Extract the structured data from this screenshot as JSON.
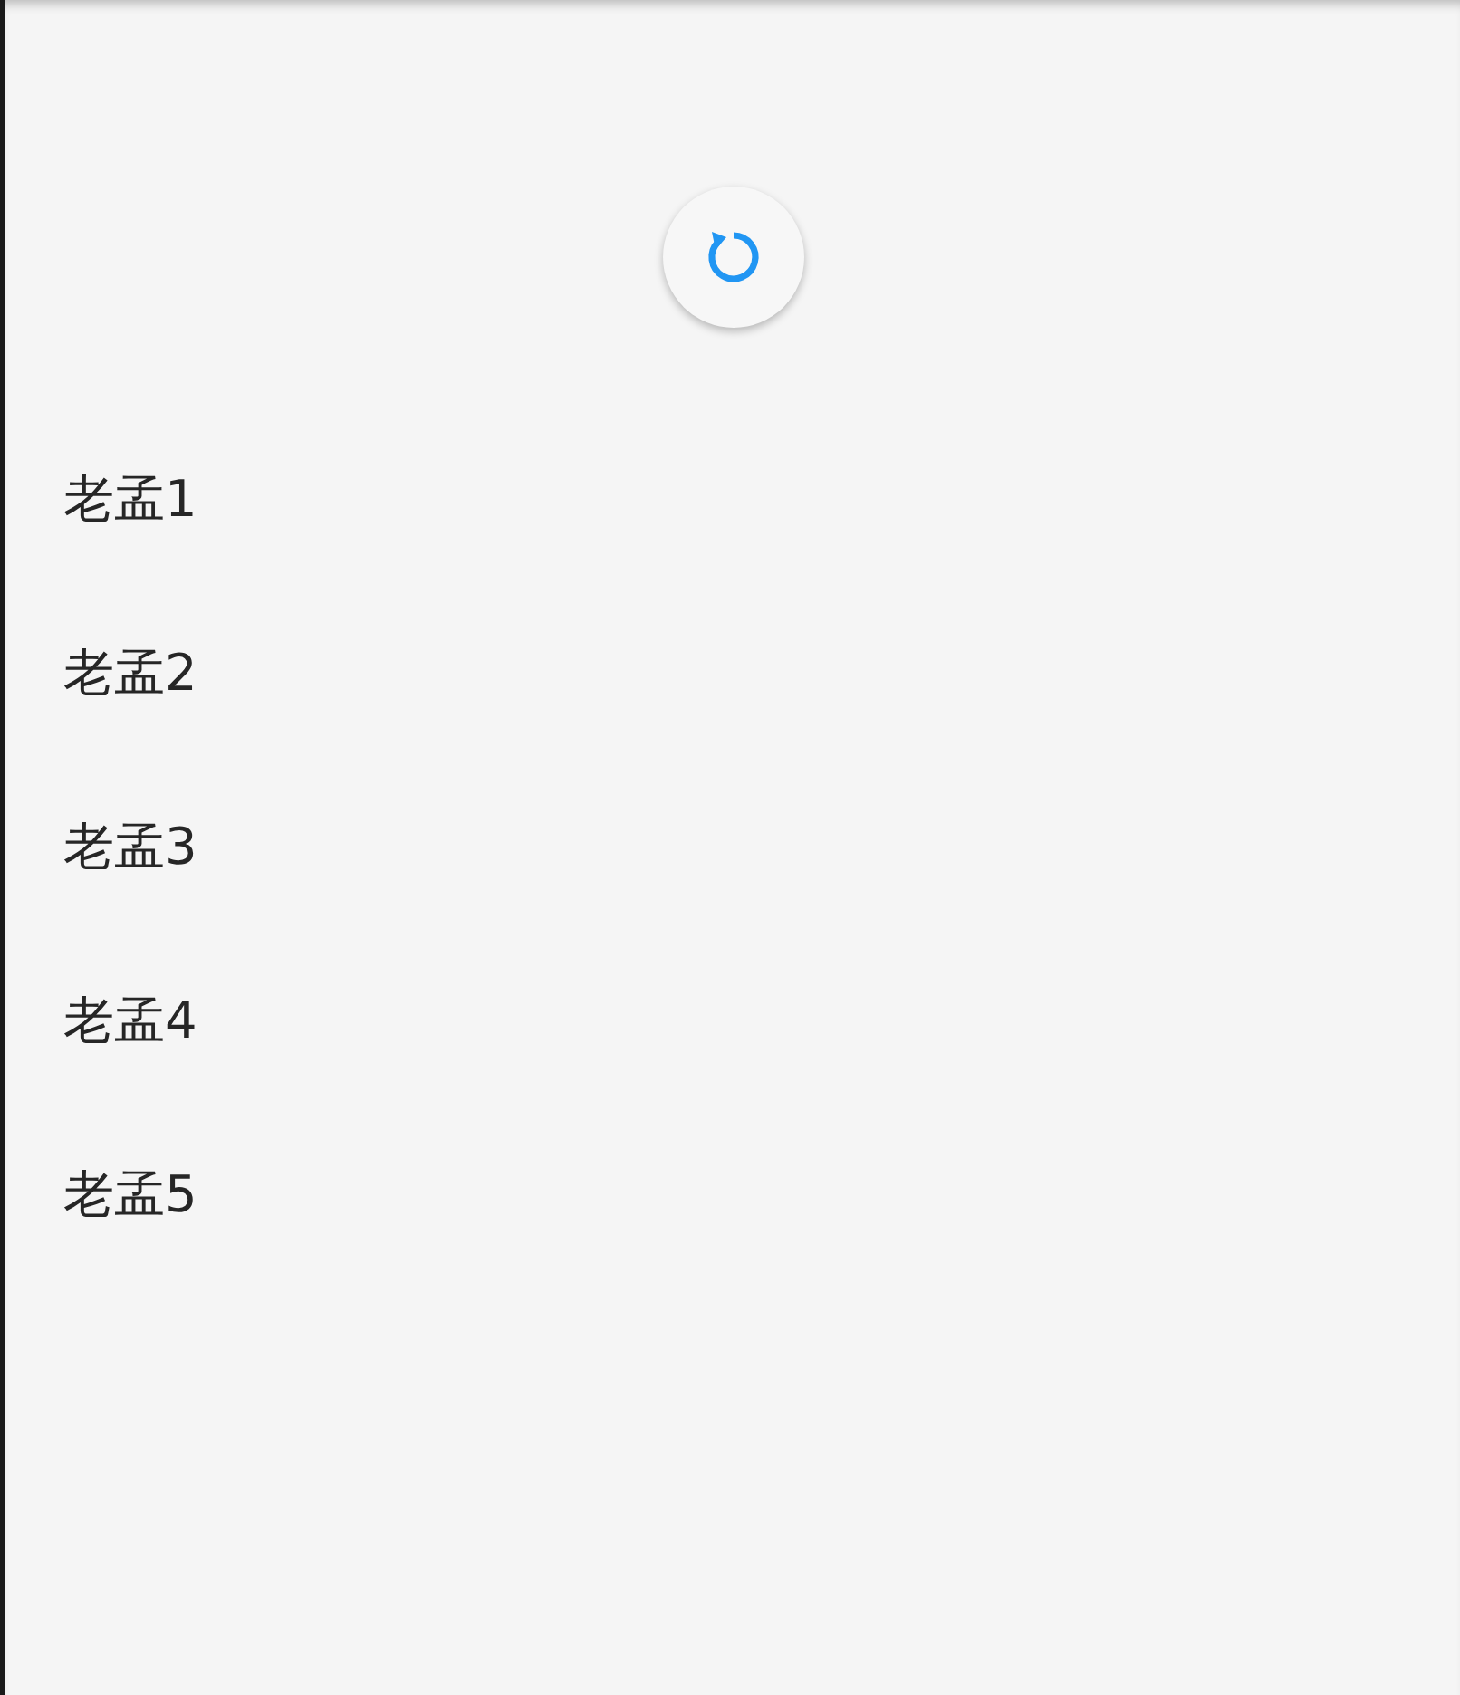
{
  "list": {
    "items": [
      {
        "label": "老孟1"
      },
      {
        "label": "老孟2"
      },
      {
        "label": "老孟3"
      },
      {
        "label": "老孟4"
      },
      {
        "label": "老孟5"
      }
    ]
  }
}
